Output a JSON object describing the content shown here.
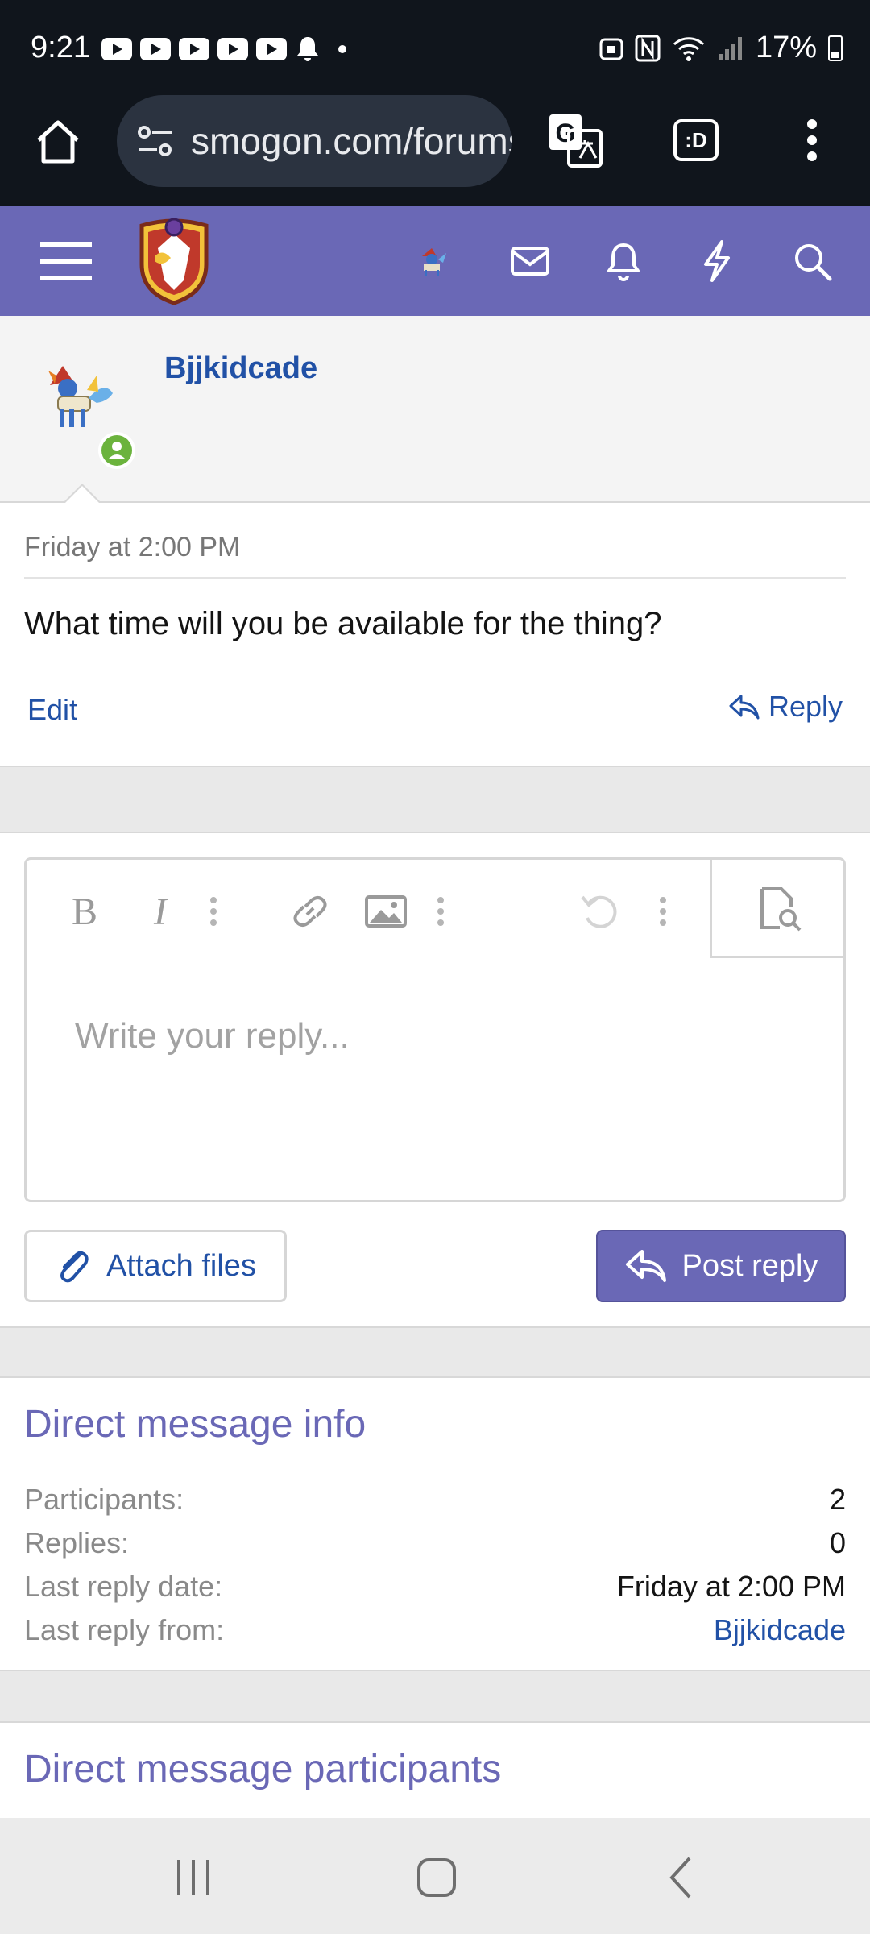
{
  "status_bar": {
    "time": "9:21",
    "battery_percent": "17%",
    "icons": [
      "youtube-icon",
      "youtube-icon",
      "youtube-icon",
      "youtube-icon",
      "youtube-icon",
      "bell-icon",
      "dot-icon",
      "nfc-icon",
      "wifi-icon",
      "signal-icon",
      "battery-icon"
    ]
  },
  "browser": {
    "url": "smogon.com/forums",
    "tabs_label": ":D"
  },
  "post": {
    "username": "Bjjkidcade",
    "date": "Friday at 2:00 PM",
    "message": "What time will you be available for the thing?",
    "edit_label": "Edit",
    "reply_label": "Reply"
  },
  "editor": {
    "placeholder": "Write your reply...",
    "attach_label": "Attach files",
    "post_reply_label": "Post reply"
  },
  "dm_info": {
    "title": "Direct message info",
    "rows": [
      {
        "key": "Participants:",
        "value": "2"
      },
      {
        "key": "Replies:",
        "value": "0"
      },
      {
        "key": "Last reply date:",
        "value": "Friday at 2:00 PM"
      },
      {
        "key": "Last reply from:",
        "value": "Bjjkidcade"
      }
    ]
  },
  "dm_participants": {
    "title": "Direct message participants"
  },
  "colors": {
    "header": "#6a68b6",
    "link": "#2151a6",
    "online": "#6bb33d"
  }
}
